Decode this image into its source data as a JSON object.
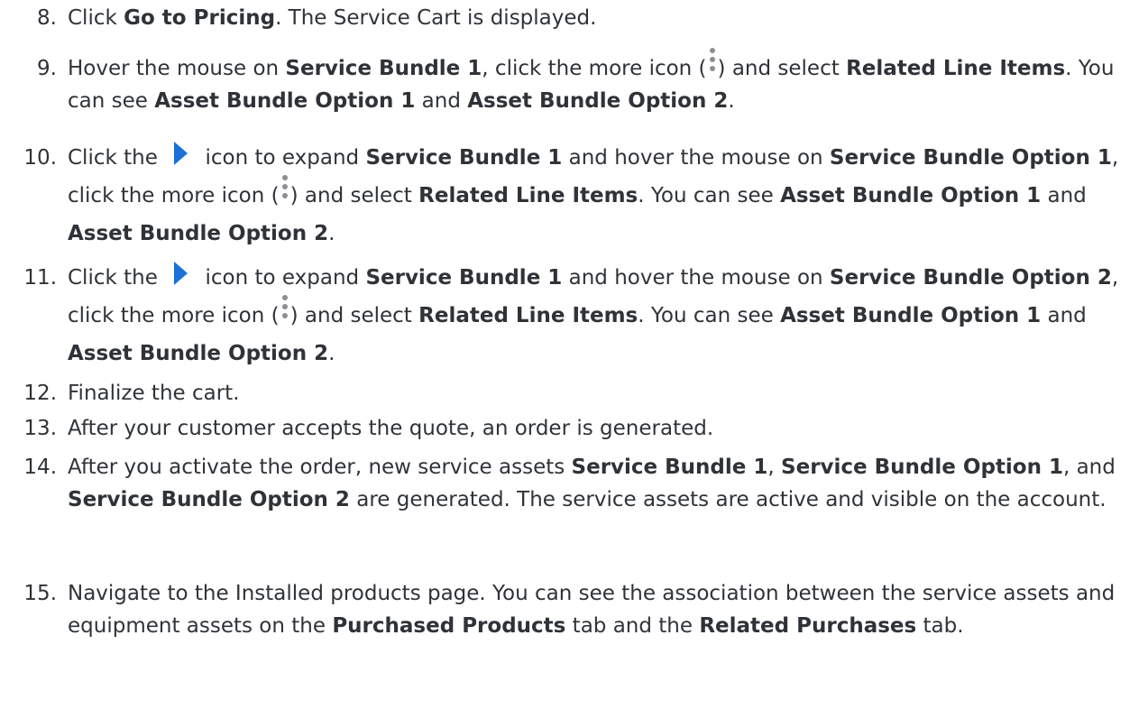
{
  "steps": [
    {
      "number": "8.",
      "parts": [
        {
          "t": "Click "
        },
        {
          "b": "Go to Pricing"
        },
        {
          "t": ". The Service Cart is displayed."
        }
      ]
    },
    {
      "number": "9.",
      "parts": [
        {
          "t": "Hover the mouse on "
        },
        {
          "b": "Service Bundle 1"
        },
        {
          "t": ", click the more icon ("
        },
        {
          "icon": "more-vertical-icon"
        },
        {
          "t": ") and select "
        },
        {
          "b": "Related Line Items"
        },
        {
          "t": ". You can see "
        },
        {
          "b": "Asset Bundle Option 1"
        },
        {
          "t": " and "
        },
        {
          "b": "Asset Bundle Option 2"
        },
        {
          "t": "."
        }
      ]
    },
    {
      "number": "10.",
      "parts": [
        {
          "t": "Click the "
        },
        {
          "icon": "expand-arrow-icon"
        },
        {
          "t": " icon to expand "
        },
        {
          "b": "Service Bundle 1"
        },
        {
          "t": " and hover the mouse on "
        },
        {
          "b": "Service Bundle Option 1"
        },
        {
          "t": ", click the more icon ("
        },
        {
          "icon": "more-vertical-icon"
        },
        {
          "t": ") and select "
        },
        {
          "b": "Related Line Items"
        },
        {
          "t": ". You can see "
        },
        {
          "b": "Asset Bundle Option 1"
        },
        {
          "t": " and "
        },
        {
          "b": "Asset Bundle Option 2"
        },
        {
          "t": "."
        }
      ]
    },
    {
      "number": "11.",
      "parts": [
        {
          "t": "Click the "
        },
        {
          "icon": "expand-arrow-icon"
        },
        {
          "t": " icon to expand "
        },
        {
          "b": "Service Bundle 1"
        },
        {
          "t": " and hover the mouse on "
        },
        {
          "b": "Service Bundle Option 2"
        },
        {
          "t": ", click the more icon ("
        },
        {
          "icon": "more-vertical-icon"
        },
        {
          "t": ") and select "
        },
        {
          "b": "Related Line Items"
        },
        {
          "t": ". You can see "
        },
        {
          "b": "Asset Bundle Option 1"
        },
        {
          "t": " and "
        },
        {
          "b": "Asset Bundle Option 2"
        },
        {
          "t": "."
        }
      ]
    },
    {
      "number": "12.",
      "parts": [
        {
          "t": "Finalize the cart."
        }
      ]
    },
    {
      "number": "13.",
      "parts": [
        {
          "t": "After your customer accepts the quote, an order is generated."
        }
      ]
    },
    {
      "number": "14.",
      "parts": [
        {
          "t": "After you activate the order, new service assets "
        },
        {
          "b": "Service Bundle 1"
        },
        {
          "t": ", "
        },
        {
          "b": "Service Bundle Option 1"
        },
        {
          "t": ", and "
        },
        {
          "b": "Service Bundle Option 2"
        },
        {
          "t": " are generated. The service assets are active and visible on the account."
        }
      ]
    },
    {
      "number": "15.",
      "parts": [
        {
          "t": "Navigate to the Installed products page. You can see the association between the service assets and equipment assets on the "
        },
        {
          "b": "Purchased Products"
        },
        {
          "t": " tab and the "
        },
        {
          "b": "Related Purchases"
        },
        {
          "t": " tab."
        }
      ]
    }
  ],
  "colors": {
    "text": "#2f3338",
    "expand_icon": "#1f6fd6",
    "more_icon": "#8b8f94"
  }
}
